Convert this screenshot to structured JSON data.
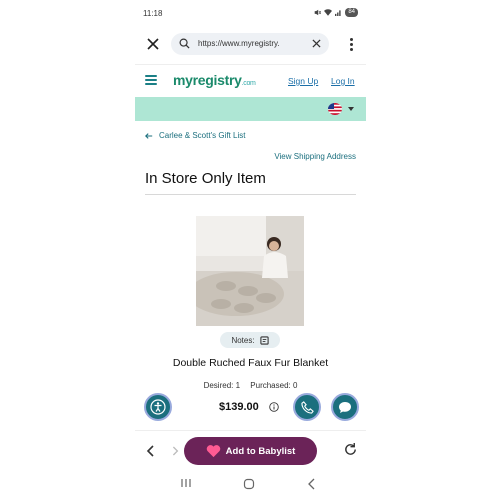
{
  "status_bar": {
    "time": "11:18",
    "battery": "84"
  },
  "browser": {
    "url": "https://www.myregistry."
  },
  "site_header": {
    "logo_main": "myregistry",
    "logo_suffix": ".com",
    "sign_up": "Sign Up",
    "log_in": "Log In"
  },
  "breadcrumb": {
    "back_label": "Carlee & Scott's Gift List",
    "shipping_label": "View Shipping Address"
  },
  "page_title": "In Store Only Item",
  "product": {
    "notes_label": "Notes:",
    "name": "Double Ruched Faux Fur Blanket",
    "desired": "Desired: 1",
    "purchased": "Purchased: 0",
    "price": "$139.00"
  },
  "bottom_bar": {
    "add_label": "Add to Babylist"
  },
  "colors": {
    "teal": "#1b6f7e",
    "mint": "#aee6d4",
    "add_button": "#6b2358",
    "logo": "#1b8a6b"
  }
}
